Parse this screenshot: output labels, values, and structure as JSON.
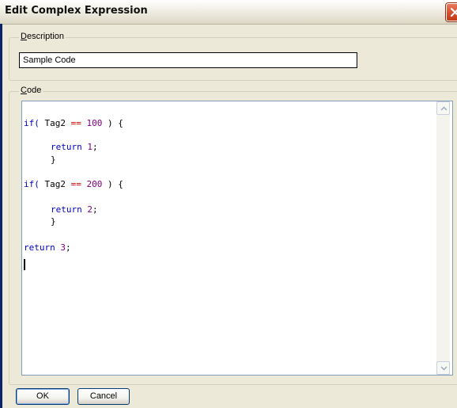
{
  "window": {
    "title": "Edit Complex Expression"
  },
  "description_group": {
    "accel": "D",
    "rest": "escription",
    "value": "Sample Code"
  },
  "code_group": {
    "accel": "C",
    "rest": "ode"
  },
  "code": {
    "line1": {
      "kw": "if(",
      "var": " Tag2 ",
      "op": "==",
      "num": " 100",
      "tail": " ) {"
    },
    "line2": {
      "kw": "return",
      "num": " 1",
      "tail": ";"
    },
    "line3": {
      "tail": "}"
    },
    "line4": {
      "kw": "if(",
      "var": " Tag2 ",
      "op": "==",
      "num": " 200",
      "tail": " ) {"
    },
    "line5": {
      "kw": "return",
      "num": " 2",
      "tail": ";"
    },
    "line6": {
      "tail": "}"
    },
    "line7": {
      "kw": "return",
      "num": " 3",
      "tail": ";"
    }
  },
  "buttons": {
    "ok": "OK",
    "cancel": "Cancel"
  },
  "icons": {
    "close": "close-icon",
    "scroll_up": "chevron-up-icon",
    "scroll_down": "chevron-down-icon"
  }
}
